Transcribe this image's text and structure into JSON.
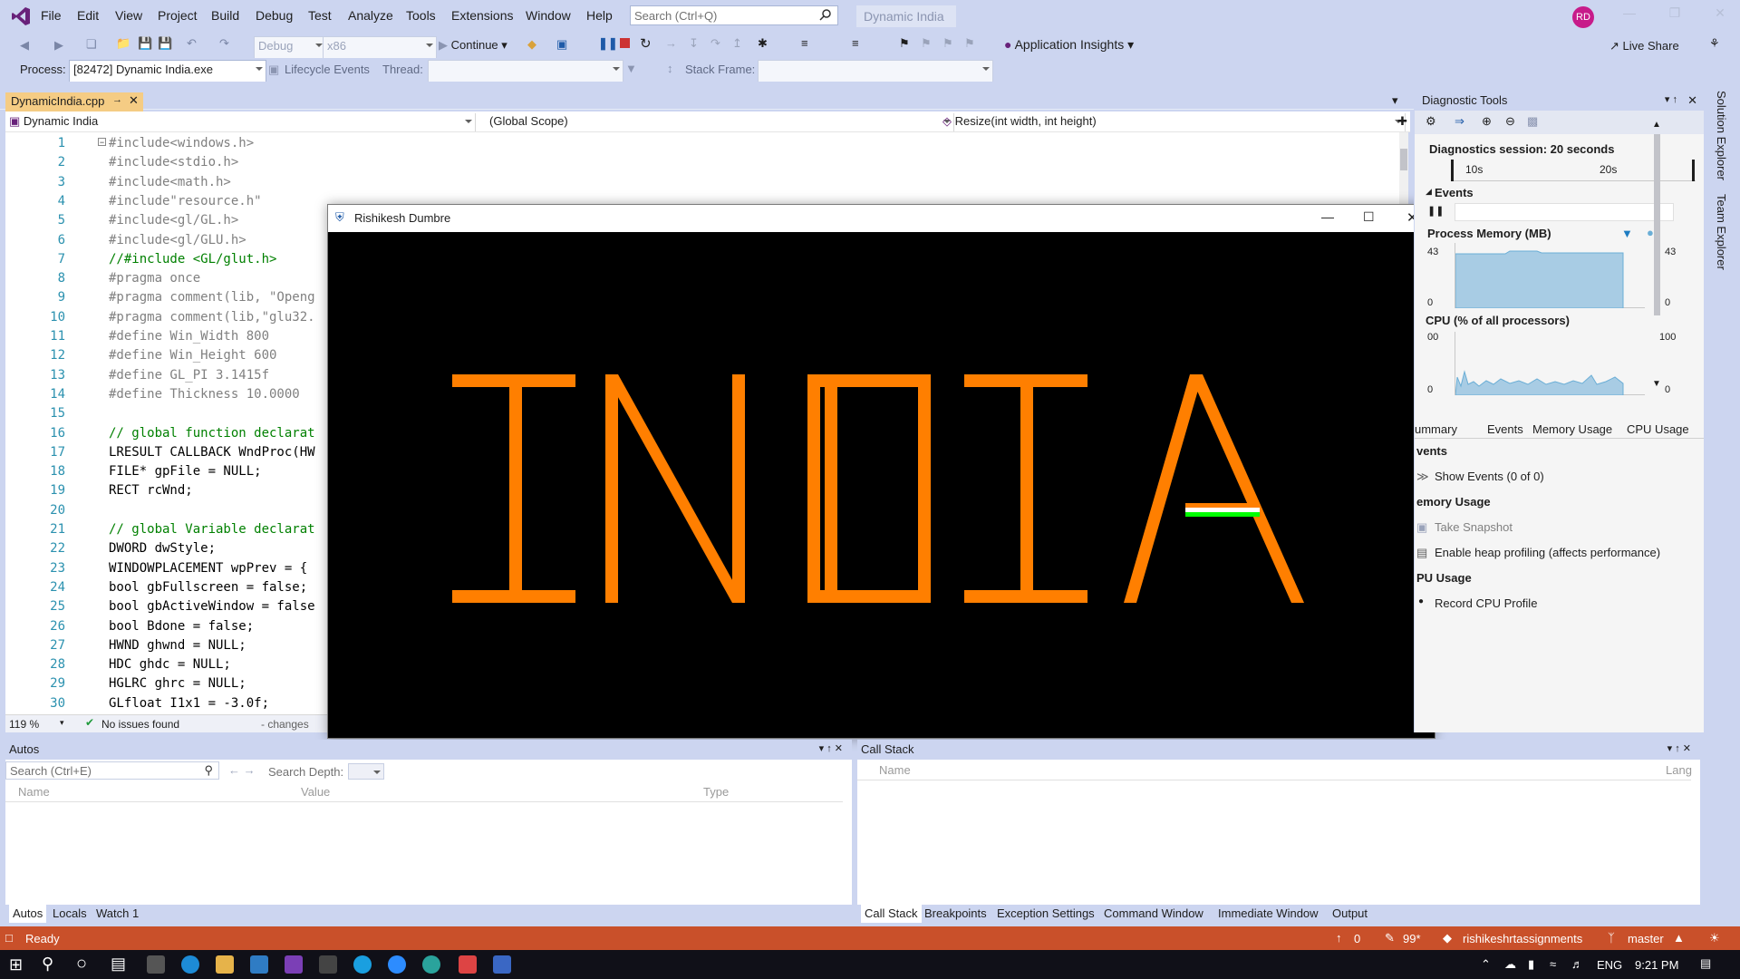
{
  "menu": {
    "items": [
      "File",
      "Edit",
      "View",
      "Project",
      "Build",
      "Debug",
      "Test",
      "Analyze",
      "Tools",
      "Extensions",
      "Window",
      "Help"
    ],
    "search_placeholder": "Search (Ctrl+Q)",
    "solution_name": "Dynamic India",
    "user_initials": "RD"
  },
  "toolbar": {
    "config": "Debug",
    "platform": "x86",
    "continue_label": "Continue",
    "app_insights": "Application Insights",
    "live_share": "Live Share",
    "process_label": "Process:",
    "process_value": "[82472] Dynamic India.exe",
    "lifecycle_label": "Lifecycle Events",
    "thread_label": "Thread:",
    "stack_frame_label": "Stack Frame:"
  },
  "editor": {
    "tab_name": "DynamicIndia.cpp",
    "nav_project": "Dynamic India",
    "nav_scope": "(Global Scope)",
    "nav_member": "Resize(int width, int height)",
    "zoom": "119 %",
    "issues": "No issues found",
    "changes": "- changes",
    "line_numbers": [
      "1",
      "2",
      "3",
      "4",
      "5",
      "6",
      "7",
      "8",
      "9",
      "10",
      "11",
      "12",
      "13",
      "14",
      "15",
      "16",
      "17",
      "18",
      "19",
      "20",
      "21",
      "22",
      "23",
      "24",
      "25",
      "26",
      "27",
      "28",
      "29",
      "30"
    ],
    "lines": [
      "#include<windows.h>",
      "#include<stdio.h>",
      "#include<math.h>",
      "#include\"resource.h\"",
      "#include<gl/GL.h>",
      "#include<gl/GLU.h>",
      "//#include <GL/glut.h>",
      "#pragma once",
      "#pragma comment(lib, \"Openg",
      "#pragma comment(lib,\"glu32.",
      "#define Win_Width 800",
      "#define Win_Height 600",
      "#define GL_PI 3.1415f",
      "#define Thickness 10.0000",
      "",
      "// global function declarat",
      "LRESULT CALLBACK WndProc(HW",
      "FILE* gpFile = NULL;",
      "RECT rcWnd;",
      "",
      "// global Variable declarat",
      "DWORD dwStyle;",
      "WINDOWPLACEMENT wpPrev = {",
      "bool gbFullscreen = false;",
      "bool gbActiveWindow = false",
      "bool Bdone = false;",
      "HWND ghwnd = NULL;",
      "HDC ghdc = NULL;",
      "HGLRC ghrc = NULL;",
      "GLfloat I1x1 = -3.0f;"
    ]
  },
  "gl_window": {
    "title": "Rishikesh Dumbre",
    "letters": [
      "I",
      "N",
      "D",
      "I",
      "A"
    ],
    "letter_color": "#ff7f00",
    "stripe_colors": [
      "#ffffff",
      "#00ff00"
    ]
  },
  "diagnostics": {
    "title": "Diagnostic Tools",
    "session": "Diagnostics session: 20 seconds",
    "tick_10s": "10s",
    "tick_20s": "20s",
    "events_label": "Events",
    "memory_label": "Process Memory (MB)",
    "memory_max": "43",
    "memory_min": "0",
    "cpu_label": "CPU (% of all processors)",
    "cpu_max_left": "00",
    "cpu_max_right": "100",
    "cpu_min": "0",
    "tabs": [
      "ummary",
      "Events",
      "Memory Usage",
      "CPU Usage"
    ],
    "section_events": "vents",
    "show_events": "Show Events (0 of 0)",
    "section_memory": "emory Usage",
    "take_snapshot": "Take Snapshot",
    "heap_profiling": "Enable heap profiling (affects performance)",
    "section_cpu": "PU Usage",
    "record_cpu": "Record CPU Profile",
    "side_tabs": [
      "Solution Explorer",
      "Team Explorer"
    ]
  },
  "autos": {
    "title": "Autos",
    "search_placeholder": "Search (Ctrl+E)",
    "search_depth": "Search Depth:",
    "columns": [
      "Name",
      "Value",
      "Type"
    ],
    "tabs": [
      "Autos",
      "Locals",
      "Watch 1"
    ]
  },
  "callstack": {
    "title": "Call Stack",
    "columns": [
      "Name",
      "Lang"
    ],
    "tabs": [
      "Call Stack",
      "Breakpoints",
      "Exception Settings",
      "Command Window",
      "Immediate Window",
      "Output"
    ]
  },
  "status": {
    "state": "Ready",
    "errors": "0",
    "pending": "99*",
    "repo": "rishikeshrtassignments",
    "branch": "master"
  },
  "taskbar": {
    "lang": "ENG",
    "time": "9:21 PM",
    "notifications": "1"
  }
}
